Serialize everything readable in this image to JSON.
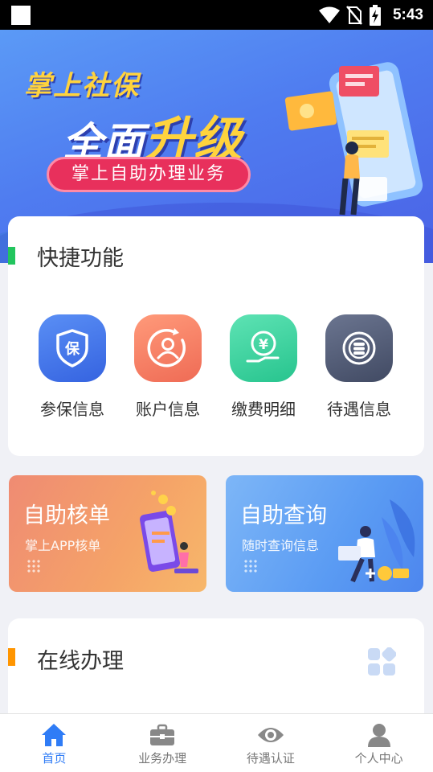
{
  "status_bar": {
    "time": "5:43",
    "icons": [
      "wifi-icon",
      "no-sim-icon",
      "battery-charging-icon"
    ]
  },
  "banner": {
    "title_line1": "掌上社保",
    "title_line2_part1": "全面",
    "title_line2_part2": "升级",
    "pill": "掌上自助办理业务"
  },
  "quick_functions": {
    "title": "快捷功能",
    "accent": "#22c55e",
    "items": [
      {
        "label": "参保信息",
        "icon": "insurance-shield-icon",
        "color": "#3b6fe8"
      },
      {
        "label": "账户信息",
        "icon": "account-user-icon",
        "color": "#f0715a"
      },
      {
        "label": "缴费明细",
        "icon": "payment-yen-icon",
        "color": "#2fcf98"
      },
      {
        "label": "待遇信息",
        "icon": "benefit-coins-icon",
        "color": "#505a72"
      }
    ]
  },
  "promos": [
    {
      "title": "自助核单",
      "subtitle": "掌上APP核单"
    },
    {
      "title": "自助查询",
      "subtitle": "随时查询信息"
    }
  ],
  "online": {
    "title": "在线办理",
    "accent": "#ff9500",
    "icon": "grid-apps-icon"
  },
  "bottom_nav": [
    {
      "label": "首页",
      "icon": "home-icon",
      "active": true
    },
    {
      "label": "业务办理",
      "icon": "briefcase-icon",
      "active": false
    },
    {
      "label": "待遇认证",
      "icon": "eye-icon",
      "active": false
    },
    {
      "label": "个人中心",
      "icon": "person-icon",
      "active": false
    }
  ]
}
